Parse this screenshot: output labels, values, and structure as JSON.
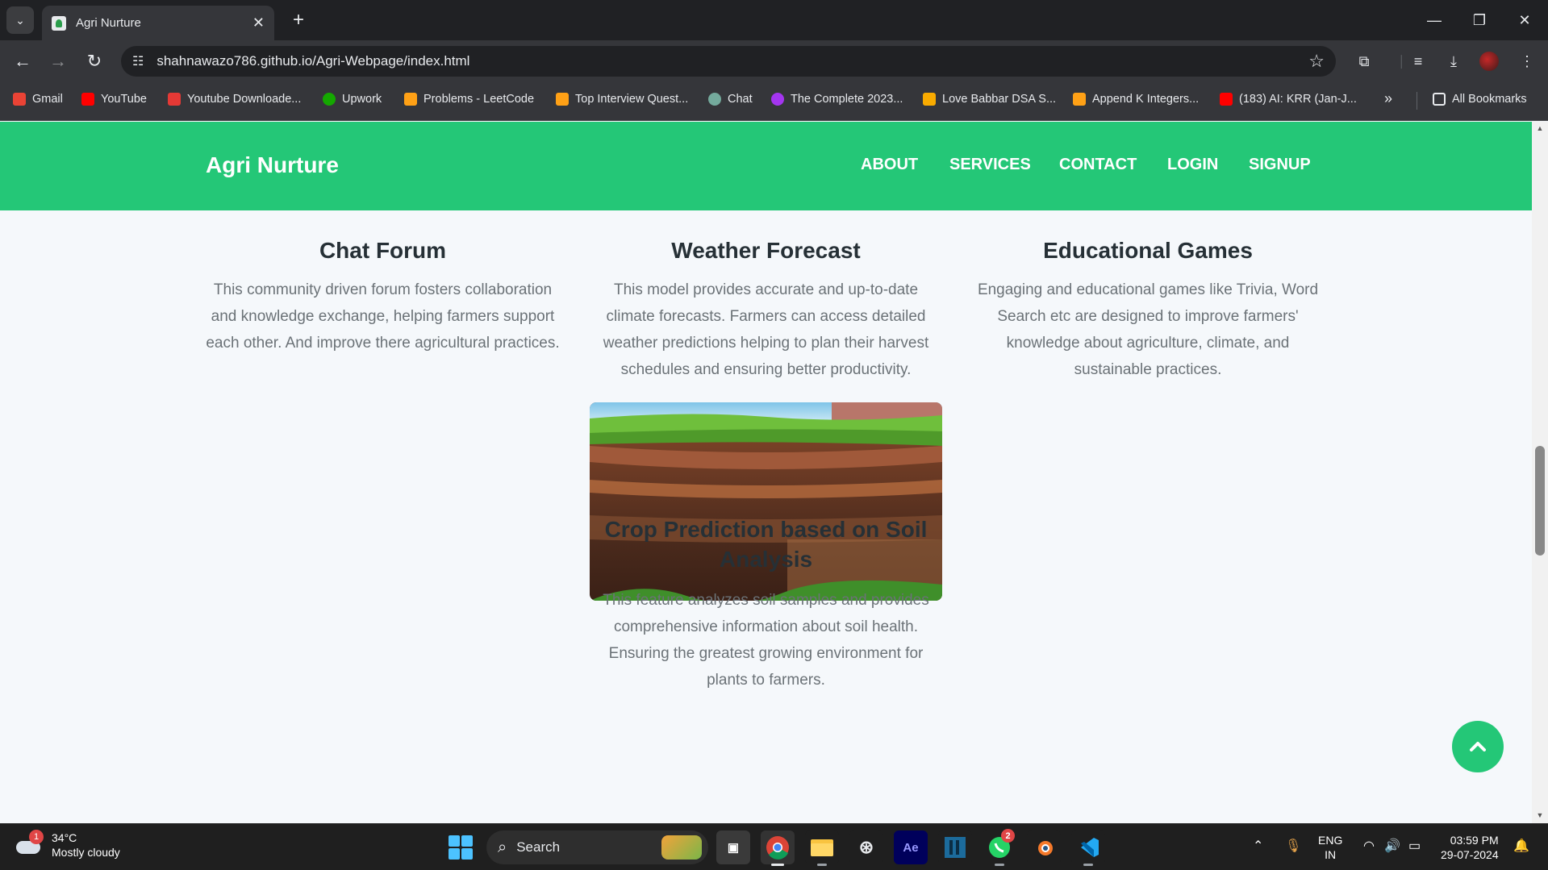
{
  "browser": {
    "tab_title": "Agri Nurture",
    "url": "shahnawazo786.github.io/Agri-Webpage/index.html",
    "bookmarks": [
      {
        "label": "Gmail",
        "icon": "gmail-icon",
        "color": "#ea4335"
      },
      {
        "label": "YouTube",
        "icon": "youtube-icon",
        "color": "#ff0000"
      },
      {
        "label": "Youtube Downloade...",
        "icon": "download-app-icon",
        "color": "#e53935"
      },
      {
        "label": "Upwork",
        "icon": "upwork-icon",
        "color": "#14a800"
      },
      {
        "label": "Problems - LeetCode",
        "icon": "leetcode-icon",
        "color": "#ffa116"
      },
      {
        "label": "Top Interview Quest...",
        "icon": "leetcode-icon",
        "color": "#ffa116"
      },
      {
        "label": "Chat",
        "icon": "chat-icon",
        "color": "#74aa9c"
      },
      {
        "label": "The Complete 2023...",
        "icon": "udemy-icon",
        "color": "#a435f0"
      },
      {
        "label": "Love Babbar DSA S...",
        "icon": "folder-doc-icon",
        "color": "#f9ab00"
      },
      {
        "label": "Append K Integers...",
        "icon": "leetcode-icon",
        "color": "#ffa116"
      },
      {
        "label": "(183) AI: KRR (Jan-J...",
        "icon": "youtube-icon",
        "color": "#ff0000"
      }
    ],
    "all_bookmarks_label": "All Bookmarks"
  },
  "site": {
    "brand": "Agri Nurture",
    "nav": [
      "ABOUT",
      "SERVICES",
      "CONTACT",
      "LOGIN",
      "SIGNUP"
    ],
    "accent_color": "#24c777"
  },
  "features": [
    {
      "title": "Chat Forum",
      "description": "This community driven forum fosters collaboration and knowledge exchange, helping farmers support each other. And improve there agricultural practices."
    },
    {
      "title": "Weather Forecast",
      "description": "This model provides accurate and up-to-date climate forecasts. Farmers can access detailed weather predictions helping to plan their harvest schedules and ensuring better productivity."
    },
    {
      "title": "Educational Games",
      "description": "Engaging and educational games like Trivia, Word Search etc are designed to improve farmers' knowledge about agriculture, climate, and sustainable practices."
    },
    {
      "title": "Crop Prediction based on Soil Analysis",
      "description": "This feature analyzes soil samples and provides comprehensive information about soil health. Ensuring the greatest growing environment for plants to farmers."
    }
  ],
  "taskbar": {
    "weather_temp": "34°C",
    "weather_desc": "Mostly cloudy",
    "weather_badge": "1",
    "search_placeholder": "Search",
    "whatsapp_badge": "2",
    "lang_top": "ENG",
    "lang_bottom": "IN",
    "time": "03:59 PM",
    "date": "29-07-2024"
  }
}
